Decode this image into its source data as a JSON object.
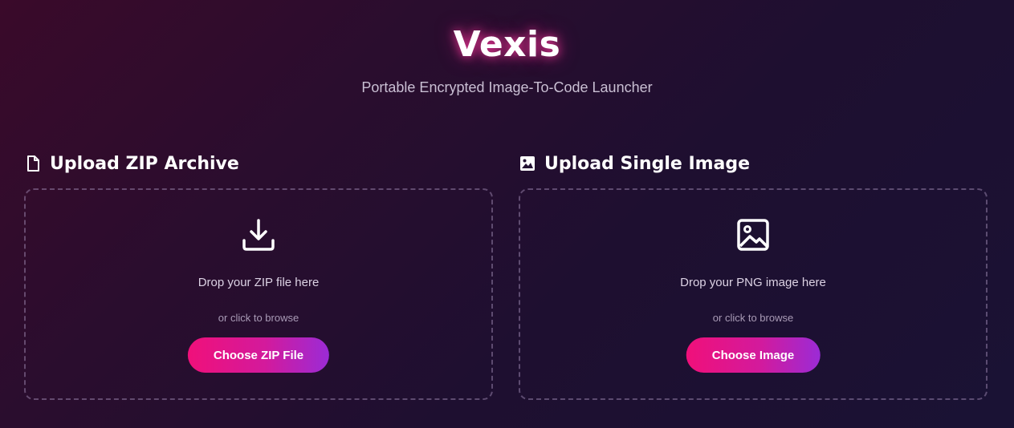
{
  "app": {
    "title": "Vexis",
    "subtitle": "Portable Encrypted Image-To-Code Launcher"
  },
  "panels": [
    {
      "heading": "Upload ZIP Archive",
      "heading_icon": "file-icon",
      "drop_icon": "download-icon",
      "drop_text": "Drop your ZIP file here",
      "browse_text": "or click to browse",
      "button_label": "Choose ZIP File"
    },
    {
      "heading": "Upload Single Image",
      "heading_icon": "image-icon",
      "drop_icon": "image-icon",
      "drop_text": "Drop your PNG image here",
      "browse_text": "or click to browse",
      "button_label": "Choose Image"
    }
  ],
  "colors": {
    "accent_start": "#f0107a",
    "accent_end": "#9b2bd6",
    "title_glow": "#ff3ca0"
  }
}
